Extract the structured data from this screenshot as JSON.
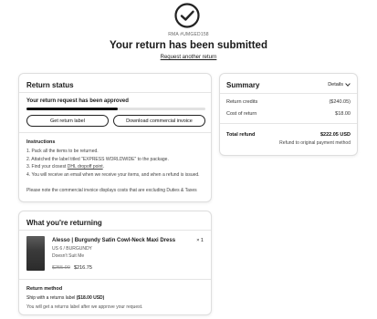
{
  "header": {
    "icon": "check-circle-icon",
    "rma": "RMA #UMGED158",
    "title": "Your return has been submitted",
    "link": "Request another return"
  },
  "status": {
    "title": "Return status",
    "approved": "Your return request has been approved",
    "progress_pct": 51,
    "btn_label": "Get return label",
    "btn_invoice": "Download commercial invoice",
    "instructions_title": "Instructions",
    "instructions": [
      "1. Pack all the items to be returned.",
      "2. Attatched the label titled \"EXPRESS WORLDWIDE\" to the package.",
      "3. Find your closest ",
      "DHL dropoff point",
      ".",
      "4. You will receive an email when we receive your items, and when a refund is issued."
    ],
    "note": "Please note the commercial invoice displays costs that are excluding Duties & Taxes"
  },
  "summary": {
    "title": "Summary",
    "details": "Details",
    "return_credits_label": "Return credits",
    "return_credits_value": "($240.05)",
    "cost_label": "Cost of return",
    "cost_value": "$18.00",
    "total_label": "Total refund",
    "total_value": "$222.05 USD",
    "refund_note": "Refund to original payment method"
  },
  "returning": {
    "title": "What you're returning",
    "item": {
      "name": "Alesso | Burgundy Satin Cowl-Neck Maxi Dress",
      "qty": "× 1",
      "variant": "US 6 / BURGUNDY",
      "reason": "Doesn't Suit Me",
      "price_old": "$255.00",
      "price_new": "$216.75"
    },
    "method_title": "Return method",
    "method_prefix": "Ship with a returns label ",
    "method_price": "($18.00 USD)",
    "method_sub": "You will get a returns label after we approve your request."
  }
}
